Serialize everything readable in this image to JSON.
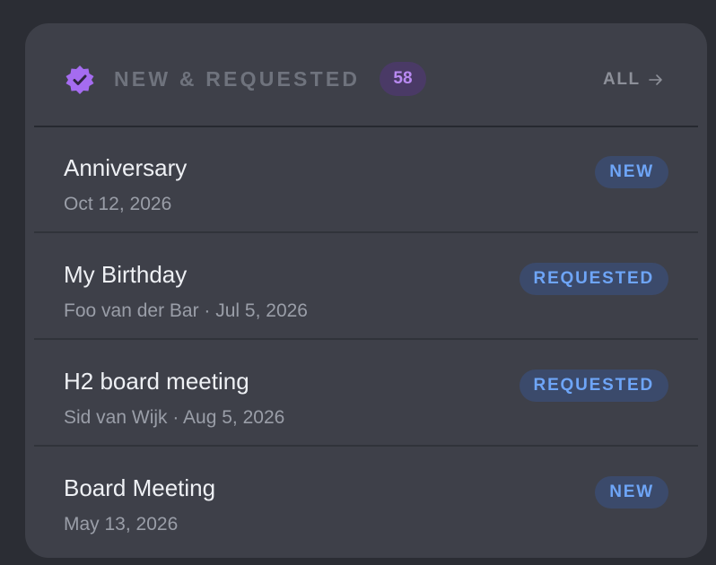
{
  "header": {
    "icon": "verified-badge-icon",
    "title": "NEW & REQUESTED",
    "count": "58",
    "all_label": "ALL",
    "accent_color": "#a56cf0"
  },
  "items": [
    {
      "title": "Anniversary",
      "subtitle": "Oct 12, 2026",
      "status": "NEW"
    },
    {
      "title": "My Birthday",
      "subtitle": "Foo van der Bar · Jul 5, 2026",
      "status": "REQUESTED"
    },
    {
      "title": "H2 board meeting",
      "subtitle": "Sid van Wijk · Aug 5, 2026",
      "status": "REQUESTED"
    },
    {
      "title": "Board Meeting",
      "subtitle": "May 13, 2026",
      "status": "NEW"
    }
  ]
}
